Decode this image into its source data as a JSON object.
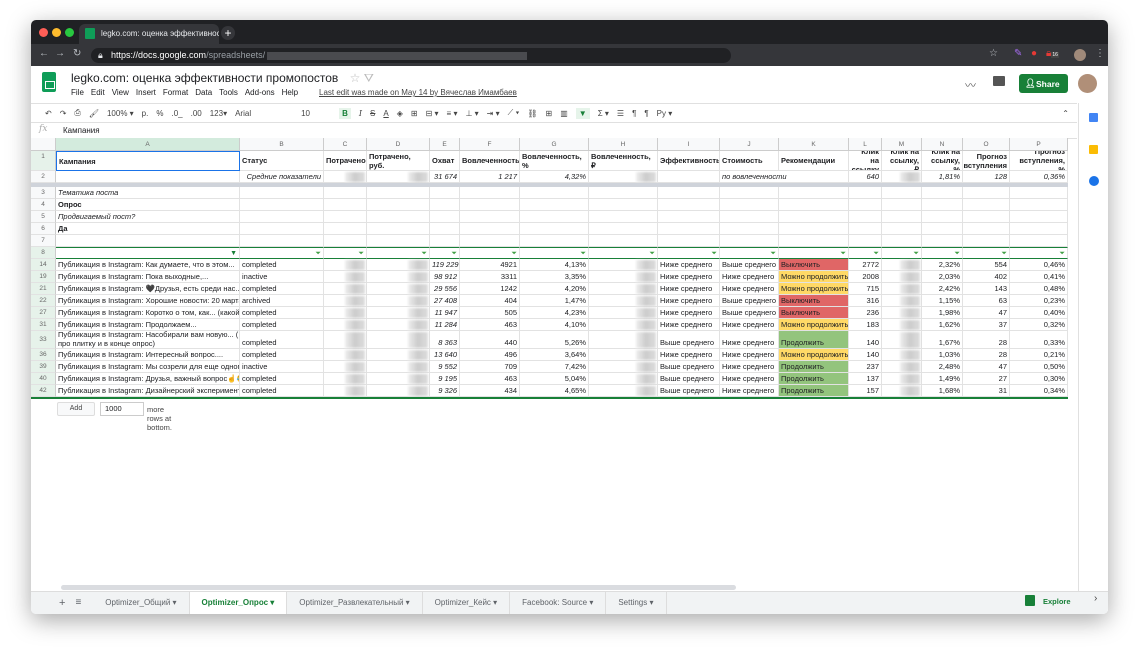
{
  "browser": {
    "tab_title": "legko.com: оценка эффективности",
    "url_host": "https://docs.google.com",
    "url_path": "/spreadsheets/",
    "ext_badge": "16"
  },
  "doc": {
    "title": "legko.com: оценка эффективности промопостов",
    "menus": [
      "File",
      "Edit",
      "View",
      "Insert",
      "Format",
      "Data",
      "Tools",
      "Add-ons",
      "Help"
    ],
    "last_edit": "Last edit was made on May 14 by Вячеслав Имамбаев",
    "share": "Share"
  },
  "toolbar": {
    "zoom": "100% ▾",
    "currency": "р.",
    "percent": "%",
    "dec_less": ".0_",
    "dec_more": ".00",
    "format": "123▾",
    "font": "Arial",
    "font_size": "10",
    "bold": "B",
    "italic": "I",
    "strike": "S",
    "textcolor": "A",
    "sum": "Σ ▾",
    "lang": "Ру ▾"
  },
  "formula": {
    "fx": "fx",
    "value": "Кампания"
  },
  "columns": [
    "A",
    "B",
    "C",
    "D",
    "E",
    "F",
    "G",
    "H",
    "I",
    "J",
    "K",
    "L",
    "M",
    "N",
    "O",
    "P"
  ],
  "header_row": [
    "Кампания",
    "Статус",
    "Потрачено",
    "Потрачено, руб.",
    "Охват",
    "Вовлеченность",
    "Вовлеченность, %",
    "Вовлеченность, ₽",
    "Эффективность",
    "Стоимость",
    "Рекомендации",
    "Клик на ссылку",
    "Клик на ссылку, ₽",
    "Клик на ссылку, %",
    "Прогноз вступления",
    "Прогноз вступления, %"
  ],
  "averages": {
    "label": "Средние показатели",
    "reach": "31 674",
    "engagement": "1 217",
    "engagement_pct": "4,32%",
    "cost_note": "по вовлеченности",
    "clicks": "640",
    "clicks_pct": "1,81%",
    "forecast": "128",
    "forecast_pct": "0,36%"
  },
  "meta_rows": [
    {
      "row": "3",
      "text": "Тематика поста",
      "style": "i"
    },
    {
      "row": "4",
      "text": "Опрос",
      "style": "b"
    },
    {
      "row": "5",
      "text": "Продвигаемый пост?",
      "style": "i"
    },
    {
      "row": "6",
      "text": "Да",
      "style": "b"
    },
    {
      "row": "7",
      "text": "",
      "style": ""
    }
  ],
  "filter_row": "8",
  "rows": [
    {
      "n": "14",
      "a": "Публикация в Instagram: Как думаете, что в этом...",
      "b": "completed",
      "e": "119 229",
      "f": "4921",
      "g": "4,13%",
      "i": "Ниже среднего",
      "j": "Выше среднего",
      "k": "Выключить",
      "kc": "#e06666",
      "l": "2772",
      "nn": "2,32%",
      "o": "554",
      "p": "0,46%"
    },
    {
      "n": "19",
      "a": "Публикация в Instagram: Пока выходные,...",
      "b": "inactive",
      "e": "98 912",
      "f": "3311",
      "g": "3,35%",
      "i": "Ниже среднего",
      "j": "Ниже среднего",
      "k": "Можно продолжить",
      "kc": "#ffd966",
      "l": "2008",
      "nn": "2,03%",
      "o": "402",
      "p": "0,41%"
    },
    {
      "n": "21",
      "a": "Публикация в Instagram: 🖤Друзья, есть среди нас...",
      "b": "completed",
      "e": "29 556",
      "f": "1242",
      "g": "4,20%",
      "i": "Ниже среднего",
      "j": "Ниже среднего",
      "k": "Можно продолжить",
      "kc": "#ffd966",
      "l": "715",
      "nn": "2,42%",
      "o": "143",
      "p": "0,48%"
    },
    {
      "n": "22",
      "a": "Публикация в Instagram: Хорошие новости: 20 марта...",
      "b": "archived",
      "e": "27 408",
      "f": "404",
      "g": "1,47%",
      "i": "Ниже среднего",
      "j": "Выше среднего",
      "k": "Выключить",
      "kc": "#e06666",
      "l": "316",
      "nn": "1,15%",
      "o": "63",
      "p": "0,23%"
    },
    {
      "n": "27",
      "a": "Публикация в Instagram: Коротко о том, как... (какой з",
      "b": "completed",
      "e": "11 947",
      "f": "505",
      "g": "4,23%",
      "i": "Ниже среднего",
      "j": "Выше среднего",
      "k": "Выключить",
      "kc": "#e06666",
      "l": "236",
      "nn": "1,98%",
      "o": "47",
      "p": "0,40%"
    },
    {
      "n": "31",
      "a": "Публикация в Instagram: Продолжаем...",
      "b": "completed",
      "e": "11 284",
      "f": "463",
      "g": "4,10%",
      "i": "Ниже среднего",
      "j": "Ниже среднего",
      "k": "Можно продолжить",
      "kc": "#ffd966",
      "l": "183",
      "nn": "1,62%",
      "o": "37",
      "p": "0,32%"
    },
    {
      "n": "33",
      "a": "Публикация в Instagram: Насобирали вам новую... (",
      "a2": "про плитку и в конце опрос)",
      "b": "completed",
      "e": "8 363",
      "f": "440",
      "g": "5,26%",
      "i": "Выше среднего",
      "j": "Ниже среднего",
      "k": "Продолжить",
      "kc": "#93c47d",
      "l": "140",
      "nn": "1,67%",
      "o": "28",
      "p": "0,33%"
    },
    {
      "n": "36",
      "a": "Публикация в Instagram: Интересный вопрос....",
      "b": "completed",
      "e": "13 640",
      "f": "496",
      "g": "3,64%",
      "i": "Ниже среднего",
      "j": "Ниже среднего",
      "k": "Можно продолжить",
      "kc": "#ffd966",
      "l": "140",
      "nn": "1,03%",
      "o": "28",
      "p": "0,21%"
    },
    {
      "n": "39",
      "a": "Публикация в Instagram: Мы созрели для еще одного",
      "b": "inactive",
      "e": "9 552",
      "f": "709",
      "g": "7,42%",
      "i": "Выше среднего",
      "j": "Ниже среднего",
      "k": "Продолжить",
      "kc": "#93c47d",
      "l": "237",
      "nn": "2,48%",
      "o": "47",
      "p": "0,50%"
    },
    {
      "n": "40",
      "a": "Публикация в Instagram: Друзья, важный вопрос☝️😂",
      "b": "completed",
      "e": "9 195",
      "f": "463",
      "g": "5,04%",
      "i": "Выше среднего",
      "j": "Ниже среднего",
      "k": "Продолжить",
      "kc": "#93c47d",
      "l": "137",
      "nn": "1,49%",
      "o": "27",
      "p": "0,30%"
    },
    {
      "n": "42",
      "a": "Публикация в Instagram: Дизайнерский эксперимент:...",
      "b": "completed",
      "e": "9 326",
      "f": "434",
      "g": "4,65%",
      "i": "Выше среднего",
      "j": "Ниже среднего",
      "k": "Продолжить",
      "kc": "#93c47d",
      "l": "157",
      "nn": "1,68%",
      "o": "31",
      "p": "0,34%"
    }
  ],
  "add_rows": {
    "button": "Add",
    "count": "1000",
    "suffix": "more rows at bottom."
  },
  "sheet_tabs": [
    {
      "label": "Optimizer_Общий ▾"
    },
    {
      "label": "Optimizer_Опрос ▾",
      "active": true
    },
    {
      "label": "Optimizer_Развлекательный ▾"
    },
    {
      "label": "Optimizer_Кейс ▾"
    },
    {
      "label": "Facebook: Source ▾"
    },
    {
      "label": "Settings ▾"
    }
  ],
  "explore": "Explore"
}
